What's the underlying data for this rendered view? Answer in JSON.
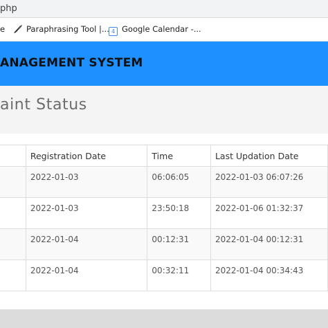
{
  "browser": {
    "url_fragment": "php",
    "bookmarks": [
      {
        "label": "e",
        "icon": "bookmark-icon"
      },
      {
        "label": "Paraphrasing Tool |...",
        "icon": "quill-icon"
      },
      {
        "label": "Google Calendar -...",
        "icon": "calendar-icon",
        "icon_text": "4"
      }
    ]
  },
  "header": {
    "title": "ANAGEMENT SYSTEM",
    "color": "#1e90ff"
  },
  "page": {
    "title": "aint Status"
  },
  "table": {
    "columns": [
      "",
      "Registration Date",
      "Time",
      "Last Updation Date"
    ],
    "rows": [
      [
        "",
        "2022-01-03",
        "06:06:05",
        "2022-01-03 06:07:26"
      ],
      [
        "",
        "2022-01-03",
        "23:50:18",
        "2022-01-06 01:32:37"
      ],
      [
        "",
        "2022-01-04",
        "00:12:31",
        "2022-01-04 00:12:31"
      ],
      [
        "",
        "2022-01-04",
        "00:32:11",
        "2022-01-04 00:34:43"
      ]
    ]
  }
}
